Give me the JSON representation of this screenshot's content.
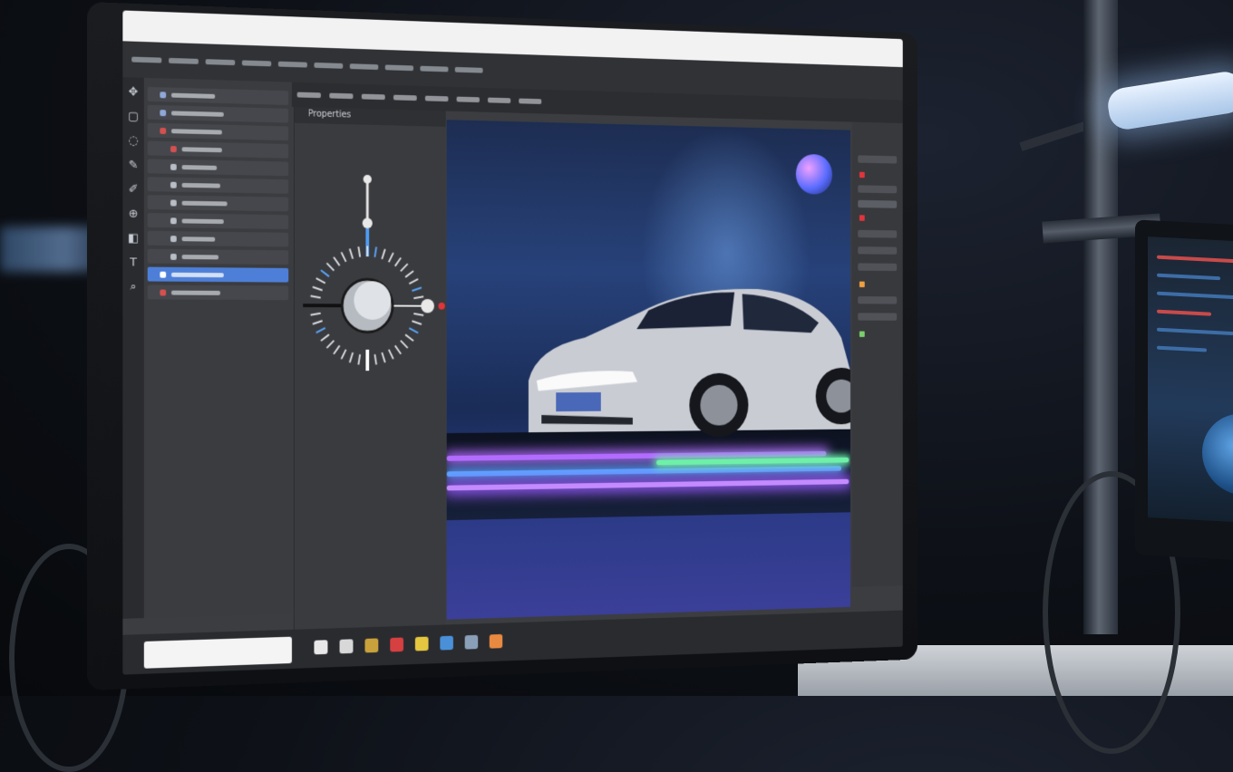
{
  "scene": {
    "colors": {
      "accent_blue": "#4e7fd8",
      "dial_red": "#e0353b",
      "neon_purple": "#b46bff",
      "neon_blue": "#59a7ff",
      "neon_green": "#6ef0a8",
      "car_body": "#c9ccd3"
    }
  },
  "window": {
    "panel_title": "Properties"
  },
  "tools": [
    "move-icon",
    "select-icon",
    "lasso-icon",
    "pen-icon",
    "brush-icon",
    "stamp-icon",
    "eraser-icon",
    "type-icon",
    "zoom-icon"
  ],
  "car": {
    "plate": ""
  },
  "monitor": {
    "brand": ""
  }
}
